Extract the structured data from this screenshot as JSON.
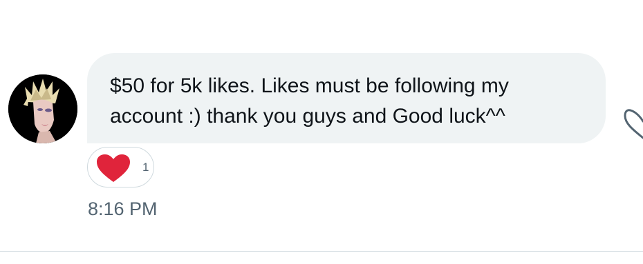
{
  "message": {
    "lines": [
      "$50 for 5k likes. Likes must be following my",
      "account :) thank you guys and Good luck^^"
    ],
    "bubble_color": "#eff3f4",
    "text_color": "#0f1419"
  },
  "reaction": {
    "icon": "heart-icon",
    "count": "1",
    "heart_color": "#e0243b"
  },
  "timestamp": "8:16 PM",
  "meta_color": "#536471"
}
